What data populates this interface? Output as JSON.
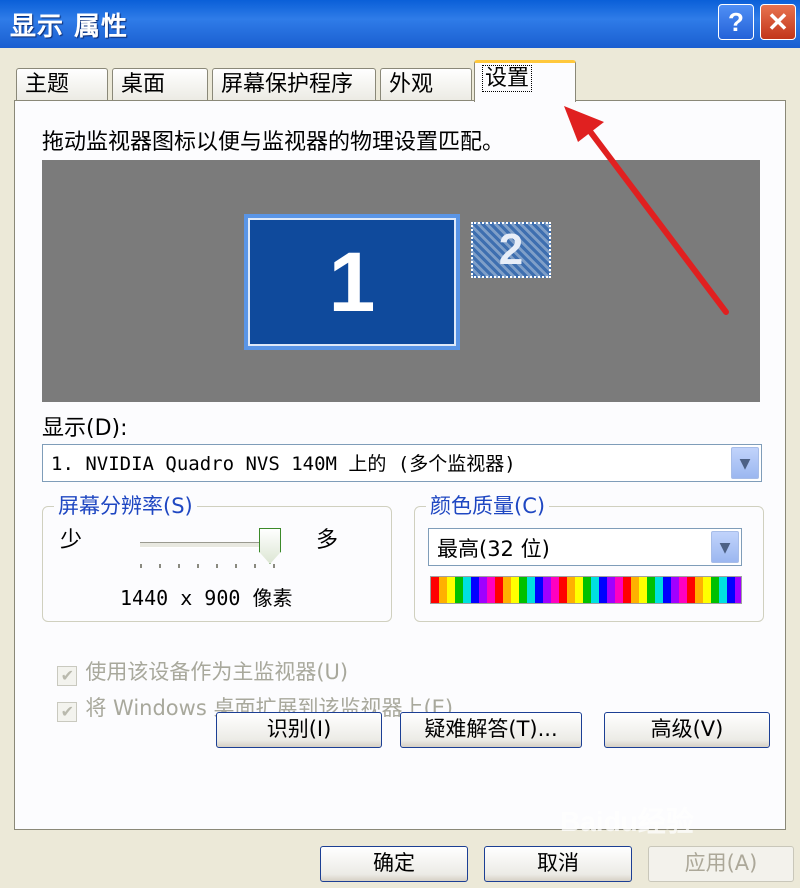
{
  "window": {
    "title": "显示 属性",
    "help_label": "?",
    "close_label": "✕"
  },
  "tabs": [
    {
      "label": "主题"
    },
    {
      "label": "桌面"
    },
    {
      "label": "屏幕保护程序"
    },
    {
      "label": "外观"
    },
    {
      "label": "设置",
      "active": true
    }
  ],
  "settings": {
    "instruction": "拖动监视器图标以便与监视器的物理设置匹配。",
    "monitors": [
      {
        "label": "1",
        "primary": true
      },
      {
        "label": "2",
        "primary": false
      }
    ],
    "display_label": "显示(D):",
    "display_value": "1. NVIDIA Quadro NVS 140M 上的 (多个监视器)",
    "resolution": {
      "legend": "屏幕分辨率(S)",
      "less_label": "少",
      "more_label": "多",
      "value": "1440 x 900 像素",
      "slider_level": 1.0
    },
    "color_quality": {
      "legend": "颜色质量(C)",
      "value": "最高(32 位)"
    },
    "checkboxes": [
      {
        "label": "使用该设备作为主监视器(U)",
        "checked": true,
        "disabled": true
      },
      {
        "label": "将 Windows 桌面扩展到该监视器上(E)",
        "checked": true,
        "disabled": true
      }
    ],
    "buttons": {
      "identify": "识别(I)",
      "troubleshoot": "疑难解答(T)...",
      "advanced": "高级(V)"
    }
  },
  "footer": {
    "ok": "确定",
    "cancel": "取消",
    "apply": "应用(A)"
  },
  "watermark": "Baidu经验",
  "colors": {
    "title_bar": "#0a5fd8",
    "primary_monitor": "#0f4a9c",
    "legend_text": "#1f47c2",
    "annotation_arrow": "#e02020"
  }
}
